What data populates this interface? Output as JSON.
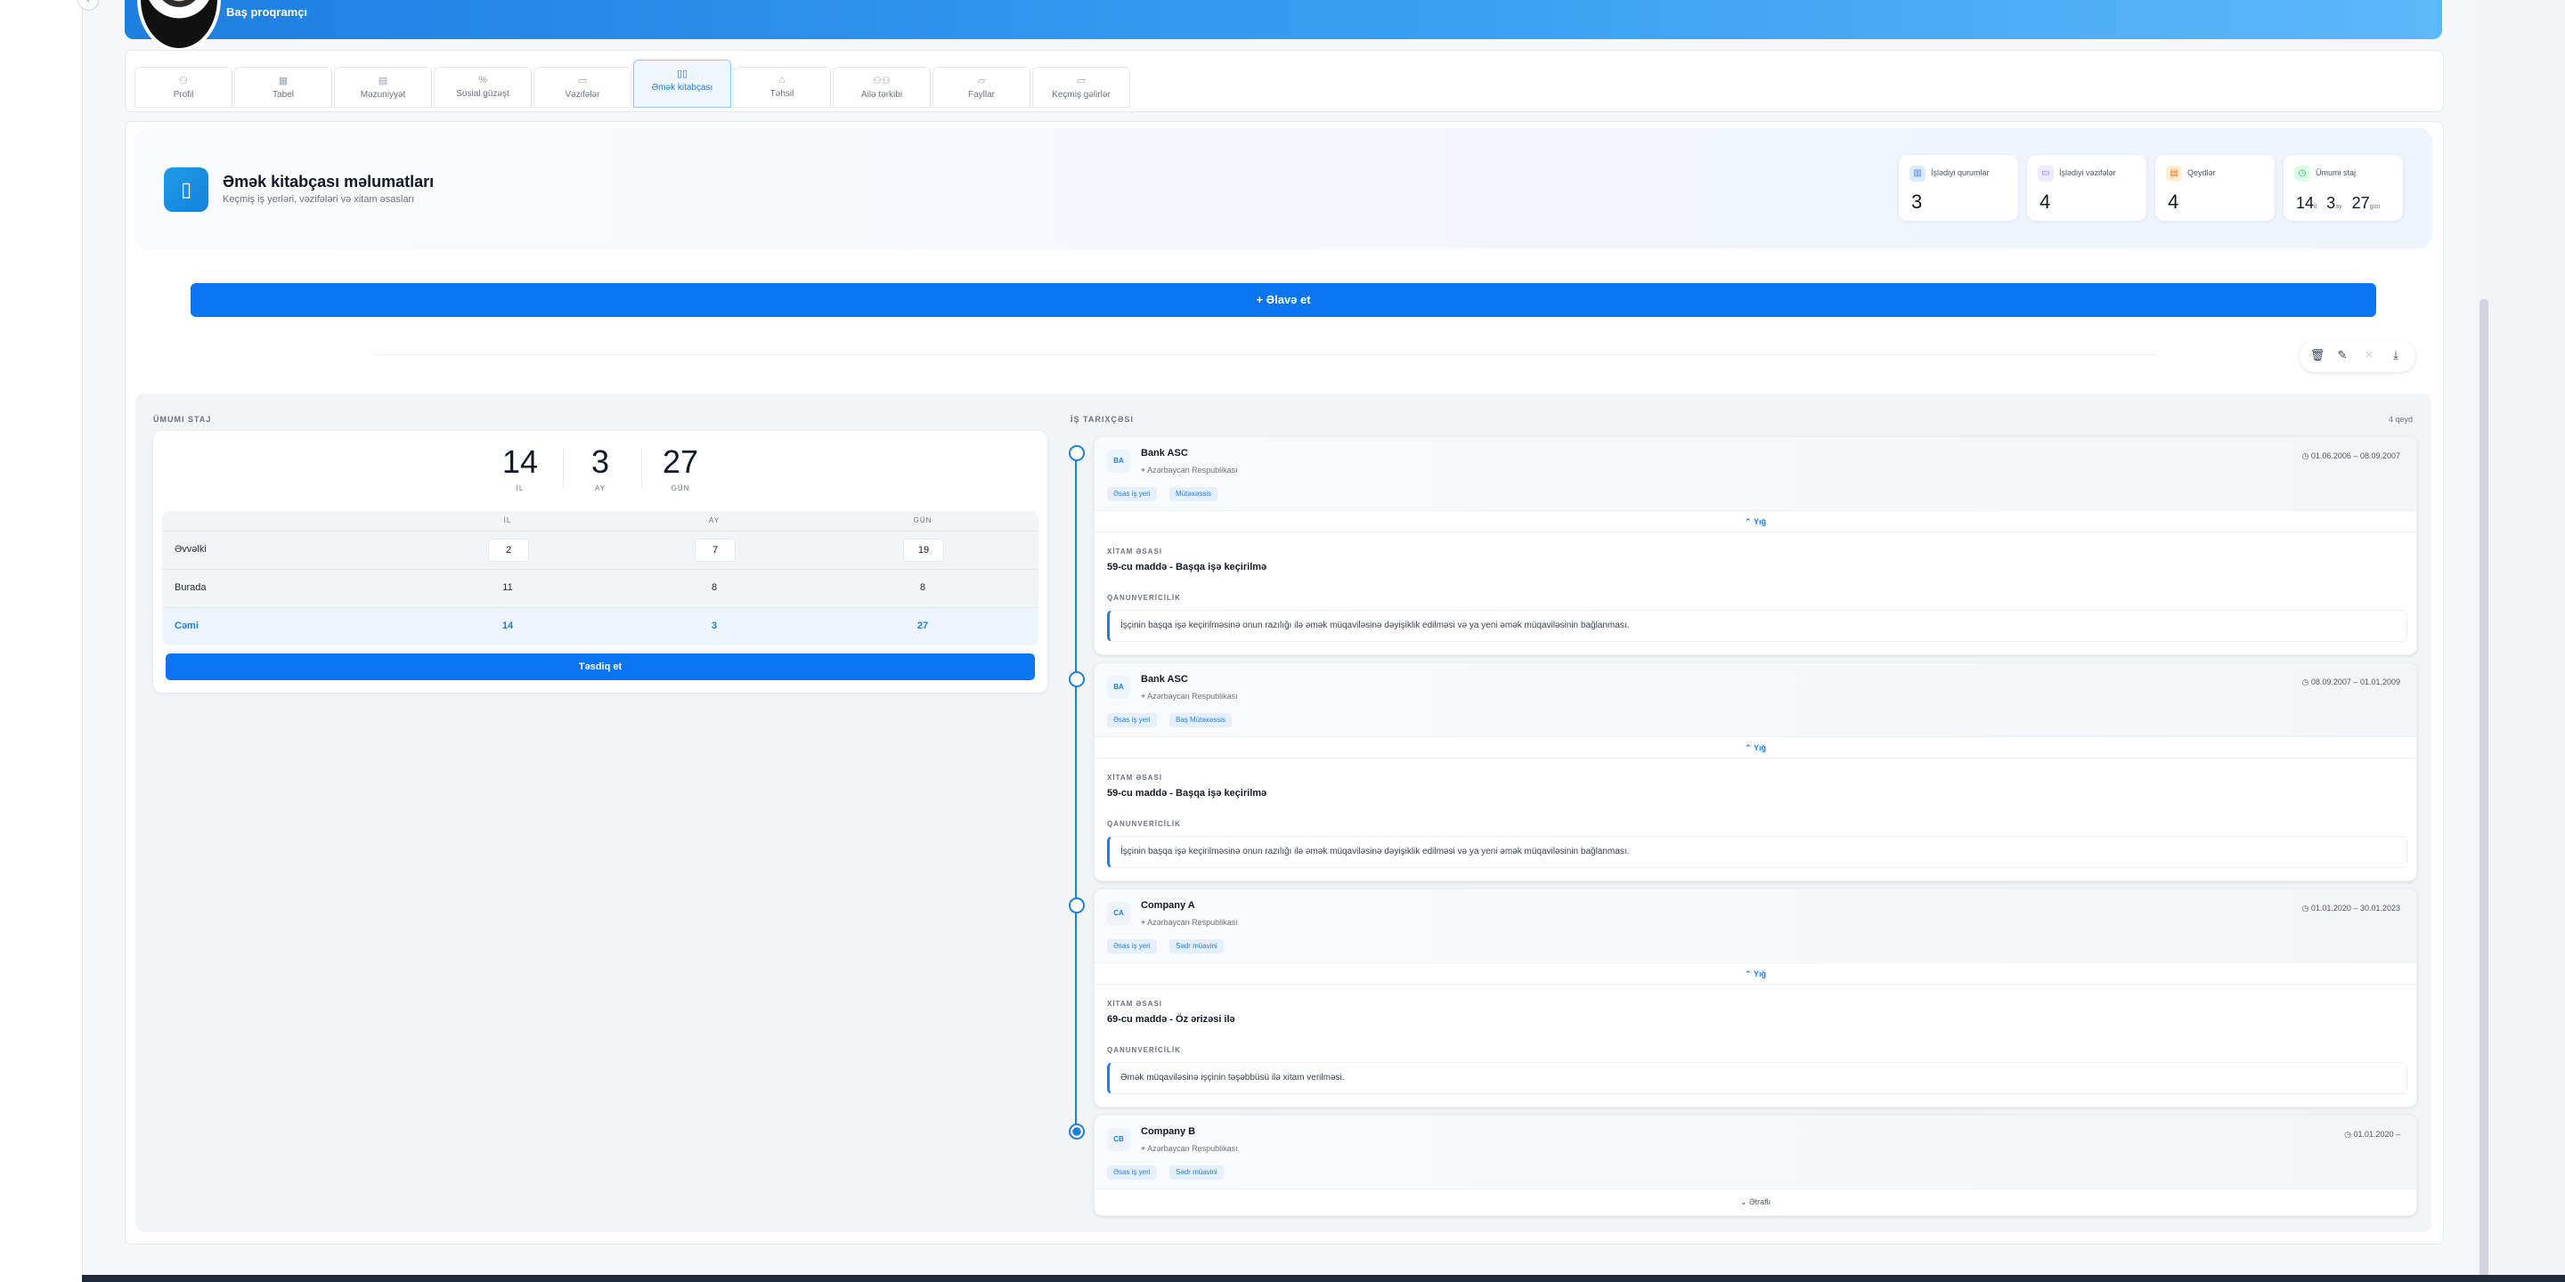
{
  "profile": {
    "role": "Baş proqramçı"
  },
  "tabs": [
    {
      "label": "Profil",
      "icon": "user-icon"
    },
    {
      "label": "Tabel",
      "icon": "calendar-icon"
    },
    {
      "label": "Məzuniyyət",
      "icon": "document-icon"
    },
    {
      "label": "Sosial güzəşt",
      "icon": "percent-icon"
    },
    {
      "label": "Vəzifələr",
      "icon": "briefcase-icon"
    },
    {
      "label": "Əmək kitabçası",
      "icon": "book-icon"
    },
    {
      "label": "Təhsil",
      "icon": "graduation-icon"
    },
    {
      "label": "Ailə tərkibi",
      "icon": "family-icon"
    },
    {
      "label": "Fayllar",
      "icon": "folder-icon"
    },
    {
      "label": "Keçmiş gəlirlər",
      "icon": "money-icon"
    }
  ],
  "info": {
    "title": "Əmək kitabçası məlumatları",
    "subtitle": "Keçmiş iş yerləri, vəzifələri və xitam əsasları"
  },
  "stats": [
    {
      "label": "İşlədiyi qurumlar",
      "value": "3",
      "color": "#3b82f6"
    },
    {
      "label": "İşlədiyi vəzifələr",
      "value": "4",
      "color": "#8b5cf6"
    },
    {
      "label": "Qeydlər",
      "value": "4",
      "color": "#f97316"
    },
    {
      "label": "Ümumi staj",
      "years": "14",
      "years_unit": "il",
      "months": "3",
      "months_unit": "ay",
      "days": "27",
      "days_unit": "gün",
      "color": "#22c55e"
    }
  ],
  "add_button": "+  Əlavə et",
  "staj": {
    "section_label": "ÜMUMI STAJ",
    "years": "14",
    "months": "3",
    "days": "27",
    "years_label": "İL",
    "months_label": "AY",
    "days_label": "GÜN",
    "col_il": "İL",
    "col_ay": "AY",
    "col_gun": "GÜN",
    "rows": [
      {
        "label": "Əvvəlki",
        "il": "2",
        "ay": "7",
        "gun": "19"
      },
      {
        "label": "Burada",
        "il": "11",
        "ay": "8",
        "gun": "8"
      },
      {
        "label": "Cəmi",
        "il": "14",
        "ay": "3",
        "gun": "27"
      }
    ],
    "confirm": "Təsdiq et"
  },
  "history": {
    "section_label": "İŞ TARIXÇƏSI",
    "count": "4 qeyd",
    "jobs": [
      {
        "initials": "BA",
        "name": "Bank ASC",
        "location": "Azərbaycan Respublikası",
        "dates": "01.06.2006 – 08.09.2007",
        "tags": [
          "Əsas iş yeri",
          "Mütəxəssis"
        ],
        "toggle": "Yığ",
        "reason_label": "XİTAM ƏSASI",
        "reason": "59-cu maddə - Başqa işə keçirilmə",
        "law_label": "QANUNVERİCİLİK",
        "law": "İşçinin başqa işə keçirilməsinə onun razılığı ilə əmək müqaviləsinə dəyişiklik edilməsi və ya yeni əmək müqaviləsinin bağlanması."
      },
      {
        "initials": "BA",
        "name": "Bank ASC",
        "location": "Azərbaycan Respublikası",
        "dates": "08.09.2007 – 01.01.2009",
        "tags": [
          "Əsas iş yeri",
          "Baş Mütəxəssis"
        ],
        "toggle": "Yığ",
        "reason_label": "XİTAM ƏSASI",
        "reason": "59-cu maddə - Başqa işə keçirilmə",
        "law_label": "QANUNVERİCİLİK",
        "law": "İşçinin başqa işə keçirilməsinə onun razılığı ilə əmək müqaviləsinə dəyişiklik edilməsi və ya yeni əmək müqaviləsinin bağlanması."
      },
      {
        "initials": "CA",
        "name": "Company A",
        "location": "Azərbaycan Respublikası",
        "dates": "01.01.2020 – 30.01.2023",
        "tags": [
          "Əsas iş yeri",
          "Sədr müavini"
        ],
        "toggle": "Yığ",
        "reason_label": "XİTAM ƏSASI",
        "reason": "69-cu maddə - Öz ərizəsi ilə",
        "law_label": "QANUNVERİCİLİK",
        "law": "Əmək müqaviləsinə işçinin təşəbbüsü ilə xitam verilməsi."
      },
      {
        "initials": "CB",
        "name": "Company B",
        "location": "Azərbaycan Respublikası",
        "dates": "01.01.2020 –",
        "tags": [
          "Əsas iş yeri",
          "Sədr müavini"
        ],
        "toggle": "Ətraflı"
      }
    ]
  }
}
